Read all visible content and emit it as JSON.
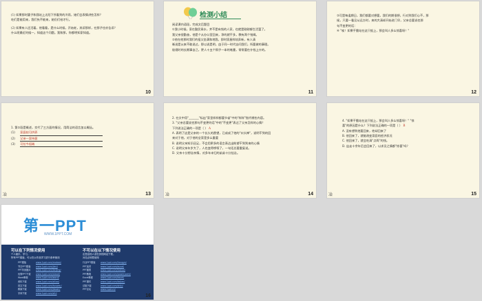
{
  "slides": [
    {
      "num": "10",
      "lines": [
        "(1) 如果那时妻子和我站上太阳下所看到的冷雨，她们会表情讲些怎样？",
        "吃们是能用来，我们先不能来，她仍们给才行。",
        "(2) 如果有人还活着，他看看，是什么时候，开始老，其诉那样，在那子也亦告诉？",
        "什么呢最近时候一，知道这个问题。我和那，你都明知家知道。"
      ]
    },
    {
      "num": "11",
      "title": "检测小结",
      "lines": [
        "阅读课内语段，完成文后题目",
        "①我小时候，家在勤民乘水，并不是有钱的人家，也就是刚刚够生活罢了。",
        "我父亲很勤奋，他是个从办公室回来，净的就干多，教有两个钱姆。",
        "②他在他那时我们的祖父坐满和地我，即时家屋样较弄新，有人清",
        "晰说是从来不敢说过，那以说是明，由于同一时代自问我们，所要做的事理。",
        "秘规时的长期事自己，更人十五个铜子一本的笔墨，常常要在什钱上什的。"
      ]
    },
    {
      "num": "12",
      "lines": [
        "③可是每逢期日，我们都要对想要，我们的期很想，行对到我们心不，那",
        "候，只要一看见从远方时，来的大清却开始进门早，父亲总要说也那",
        "句不变更的话：",
        "④ \"唉！如果干脆站在这只船上，那会叫人多么惊喜呀！\""
      ]
    },
    {
      "num": "13",
      "lines": [
        "1. 第②段是概述，交代了三方面的情况，用简洁的语言加以概括。",
        "(1)",
        "(2)",
        "(3)"
      ],
      "answers": [
        "家庭较可供养",
        "父亲一家待客",
        "可拉今祖端"
      ]
    },
    {
      "num": "14",
      "lines": [
        "2. 在文中用\"_______\"标出\"家里样样都要节省\"中的\"样样\"指代哪些内容。",
        "3. \"父亲总要说也那句不变更的话\"中的\"不变更\"表达了父亲怎样的心情？",
        "下列说法正确的一项是（ ）",
        "A. 表明了这是父亲的一个长久的愿望，已成成了他的\"口头禅\"，说明干到的回",
        "来对于他，对于他的全家是多么重要",
        "B. 说明父亲知识还足，不会用更多的语言表达出盼望干到到来的心情",
        "C. 说明父亲年岁大了，人也变得啰嗦了，一句话总要重复说。",
        "D. 父亲十分想念亲情，对多年未归的弟弟十分挂念。"
      ],
      "answer_mark": "A"
    },
    {
      "num": "15",
      "lines": [
        "4. \"如果干脆站在这只船上，那会叫人多么惊喜呀！\" \"惊",
        "喜\"的原因是什么？下列说法正确的一项是（ ）",
        "A. 没有想到他要回来，他却回来了",
        "B. 他回来了，就能改变家庭的经济状况",
        "C. 他回来了，就会吃清\"点两\"的钱。",
        "D. 出走十余年后会回来了，以求见之情都\"惊喜\"吗？"
      ],
      "answer_mark": "B"
    },
    {
      "num": "16",
      "logo": "第一PPT",
      "url": "WWW.1PPT.COM",
      "left_head": "可以在下列情况使用",
      "left_sub": [
        "个人娱乐、学习、",
        "所有PPT模板，可以在以作品学习进行参考使用"
      ],
      "right_head": "不可以在以下情况使用",
      "right_sub": [
        "出售给他人或在其他网站下载。",
        "对站点转载使用"
      ],
      "left_list": [
        [
          "PPT模板",
          "www.1ppt.com/moban/"
        ],
        [
          "节日PPT模板",
          "www.1ppt.com/jieri/"
        ],
        [
          "PPT背景图片",
          "www.1ppt.com/beijing/"
        ],
        [
          "优秀PPT下载",
          "www.1ppt.com/xiazai/"
        ],
        [
          "Word教程",
          "www.1ppt.com/word/"
        ],
        [
          "资料下载",
          "www.1ppt.com/ziliao/"
        ],
        [
          "范文下载",
          "www.1ppt.com/fanwen/"
        ],
        [
          "教案下载",
          "www.1ppt.com/jiaoan/"
        ],
        [
          "字体下载",
          "www.1ppt.com/ziti/"
        ]
      ],
      "right_list": [
        [
          "行业PPT模板",
          "www.1ppt.com/hangye/"
        ],
        [
          "PPT素材",
          "www.1ppt.com/sucai/"
        ],
        [
          "PPT图表",
          "www.1ppt.com/tubiao/"
        ],
        [
          "PPT教程",
          "www.1ppt.com/powerpoint/"
        ],
        [
          "Excel教程",
          "www.1ppt.com/excel/"
        ],
        [
          "PPT课件",
          "www.1ppt.com/kejian/"
        ],
        [
          "试卷下载",
          "www.1ppt.com/shiti/"
        ],
        [
          "PPT论坛",
          "www.1ppt.cn/"
        ]
      ]
    }
  ],
  "footer_mark": "冶",
  "colors": {
    "slide_bg": "#faf6e3",
    "accent_green": "#2e8b57",
    "answer_red": "#c0392b",
    "panel_blue": "#1f3a6b"
  }
}
